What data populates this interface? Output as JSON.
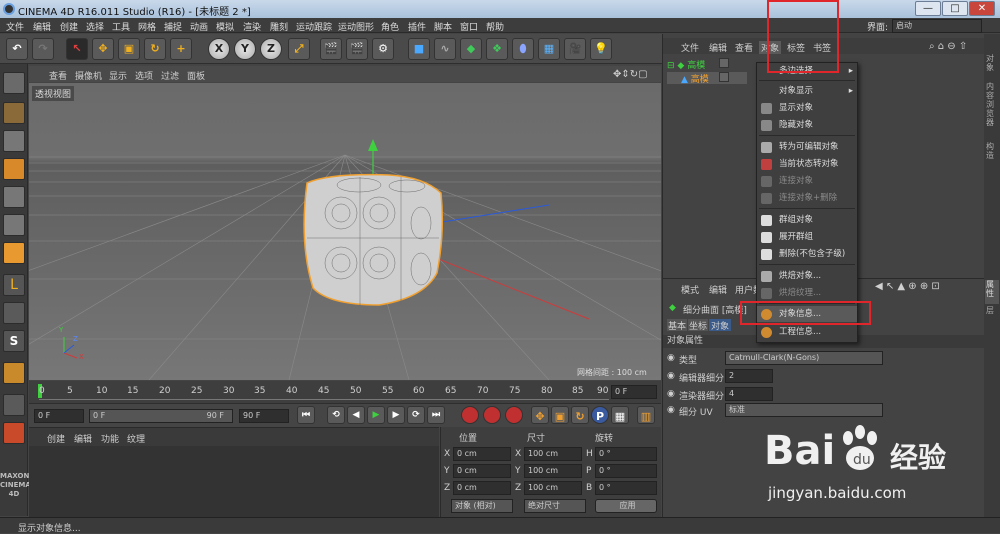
{
  "window": {
    "title": "CINEMA 4D R16.011 Studio (R16) - [未标题 2 *]",
    "layout_label": "界面:",
    "layout_value": "启动",
    "min": "—",
    "max": "□",
    "close": "✕"
  },
  "menubar": [
    "文件",
    "编辑",
    "创建",
    "选择",
    "工具",
    "网格",
    "捕捉",
    "动画",
    "模拟",
    "渲染",
    "雕刻",
    "运动跟踪",
    "运动图形",
    "角色",
    "插件",
    "脚本",
    "窗口",
    "帮助"
  ],
  "toolbar": {
    "x": "X",
    "y": "Y",
    "z": "Z"
  },
  "viewport": {
    "menu": [
      "查看",
      "摄像机",
      "显示",
      "选项",
      "过滤",
      "面板"
    ],
    "label": "透视视图",
    "grid_info": "网格间距 : 100 cm",
    "axis_y": "Y",
    "axis_z": "Z",
    "axis_x": "X"
  },
  "timeline": {
    "ticks": [
      "0",
      "5",
      "10",
      "15",
      "20",
      "25",
      "30",
      "35",
      "40",
      "45",
      "50",
      "55",
      "60",
      "65",
      "70",
      "75",
      "80",
      "85",
      "90"
    ],
    "frame_field": "0 F"
  },
  "transport": {
    "start": "0 F",
    "cur": "0 F",
    "end": "90 F",
    "end2": "90 F"
  },
  "material": {
    "menu": [
      "创建",
      "编辑",
      "功能",
      "纹理"
    ]
  },
  "coords": {
    "headers": [
      "位置",
      "尺寸",
      "旋转"
    ],
    "rows": [
      {
        "axis": "X",
        "pos": "0 cm",
        "size": "100 cm",
        "rot_label": "H",
        "rot": "0 °"
      },
      {
        "axis": "Y",
        "pos": "0 cm",
        "size": "100 cm",
        "rot_label": "P",
        "rot": "0 °"
      },
      {
        "axis": "Z",
        "pos": "0 cm",
        "size": "100 cm",
        "rot_label": "B",
        "rot": "0 °"
      }
    ],
    "mode": "对象 (相对)",
    "size_mode": "绝对尺寸",
    "apply": "应用"
  },
  "objects": {
    "menu": [
      "文件",
      "编辑",
      "查看",
      "对象",
      "标签",
      "书签"
    ],
    "items": [
      "高模",
      "高模"
    ]
  },
  "dropdown": {
    "items": [
      {
        "label": "多边选择",
        "disabled": false,
        "arrow": true
      },
      {
        "label": "对象显示",
        "disabled": false,
        "arrow": true
      },
      {
        "label": "显示对象",
        "disabled": false
      },
      {
        "label": "隐藏对象",
        "disabled": false
      },
      {
        "label": "转为可编辑对象",
        "disabled": false
      },
      {
        "label": "当前状态转对象",
        "disabled": false
      },
      {
        "label": "连接对象",
        "disabled": true
      },
      {
        "label": "连接对象+删除",
        "disabled": true
      },
      {
        "label": "群组对象",
        "disabled": false
      },
      {
        "label": "展开群组",
        "disabled": false
      },
      {
        "label": "删除(不包含子级)",
        "disabled": false
      },
      {
        "label": "烘焙对象...",
        "disabled": false
      },
      {
        "label": "烘焙纹理...",
        "disabled": true
      },
      {
        "label": "对象信息...",
        "disabled": false
      },
      {
        "label": "工程信息...",
        "disabled": false
      }
    ]
  },
  "attributes": {
    "menu": [
      "模式",
      "编辑",
      "用户数"
    ],
    "object_title": "细分曲面 [高模]",
    "tabs": [
      "基本",
      "坐标",
      "对象"
    ],
    "section": "对象属性",
    "fields": [
      {
        "label": "类型",
        "value": "Catmull-Clark(N-Gons)"
      },
      {
        "label": "编辑器细分",
        "value": "2"
      },
      {
        "label": "渲染器细分",
        "value": "4"
      },
      {
        "label": "细分 UV",
        "value": "标准"
      }
    ]
  },
  "right_tabs": [
    "属性",
    "层"
  ],
  "side_tabs": [
    "对象",
    "内容浏览器",
    "构造"
  ],
  "brand": {
    "line1": "MAXON",
    "line2": "CINEMA 4D"
  },
  "status": "显示对象信息...",
  "watermark": {
    "brand": "Bai",
    "brand2": "经验",
    "url": "jingyan.baidu.com"
  },
  "colors": {
    "highlight_red": "#e0262b",
    "accent_orange": "#f0a030",
    "menu_hover": "#5a5a5a"
  }
}
